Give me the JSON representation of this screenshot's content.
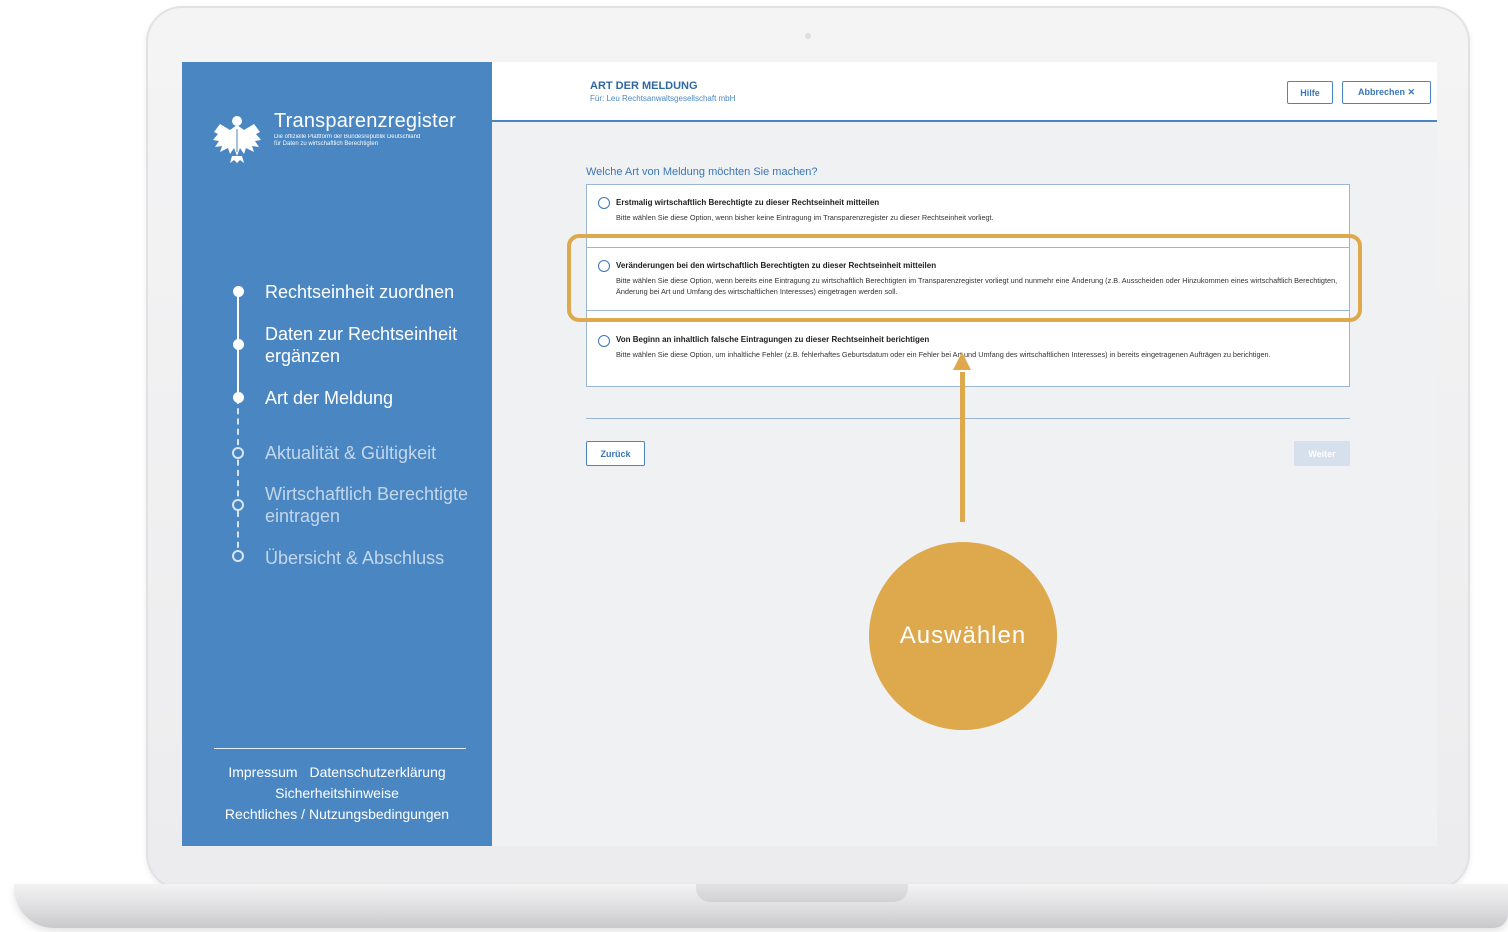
{
  "colors": {
    "sidebar": "#4a87c2",
    "accent": "#3a76b5",
    "highlight": "#dea84d",
    "disabled_button": "#d5e0ec"
  },
  "sidebar": {
    "brand_title": "Transparenzregister",
    "brand_subtitle_line1": "Die offizielle Plattform der Bundesrepublik Deutschland",
    "brand_subtitle_line2": "für Daten zu wirtschaftlich Berechtigten",
    "logo_icon": "federal-eagle-icon",
    "steps": [
      {
        "label": "Rechtseinheit zuordnen",
        "state": "done"
      },
      {
        "label": "Daten zur Rechtseinheit ergänzen",
        "state": "done"
      },
      {
        "label": "Art der Meldung",
        "state": "current"
      },
      {
        "label": "Aktualität & Gültigkeit",
        "state": "todo"
      },
      {
        "label": "Wirtschaftlich Berechtigte eintragen",
        "state": "todo"
      },
      {
        "label": "Übersicht & Abschluss",
        "state": "todo"
      }
    ],
    "footer": {
      "impressum": "Impressum",
      "datenschutz": "Datenschutzerklärung",
      "sicherheit": "Sicherheitshinweise",
      "rechtliches": "Rechtliches / Nutzungsbedingungen"
    }
  },
  "header": {
    "title": "ART DER MELDUNG",
    "subtitle": "Für: Leu Rechtsanwaltsgesellschaft mbH",
    "help_label": "Hilfe",
    "cancel_label": "Abbrechen ✕"
  },
  "main": {
    "question": "Welche Art von Meldung möchten Sie machen?",
    "options": [
      {
        "title": "Erstmalig wirtschaftlich Berechtigte zu dieser Rechtseinheit mitteilen",
        "desc": "Bitte wählen Sie diese Option, wenn bisher keine Eintragung im Transparenzregister zu dieser Rechtseinheit vorliegt."
      },
      {
        "title": "Veränderungen bei den wirtschaftlich Berechtigten zu dieser Rechtseinheit mitteilen",
        "desc": "Bitte wählen Sie diese Option, wenn bereits eine Eintragung zu wirtschaftlich Berechtigten im Transparenzregister vorliegt und nunmehr eine Änderung (z.B. Ausscheiden oder Hinzukommen eines wirtschaftlich Berechtigten, Änderung bei Art und Umfang des wirtschaftlichen Interesses) eingetragen werden soll."
      },
      {
        "title": "Von Beginn an inhaltlich falsche Eintragungen zu dieser Rechtseinheit berichtigen",
        "desc": "Bitte wählen Sie diese Option, um inhaltliche Fehler (z.B. fehlerhaftes Geburtsdatum oder ein Fehler bei Art und Umfang des wirtschaftlichen Interesses) in bereits eingetragenen Aufträgen zu berichtigen."
      }
    ],
    "back_label": "Zurück",
    "next_label": "Weiter"
  },
  "callout": {
    "label": "Auswählen"
  }
}
